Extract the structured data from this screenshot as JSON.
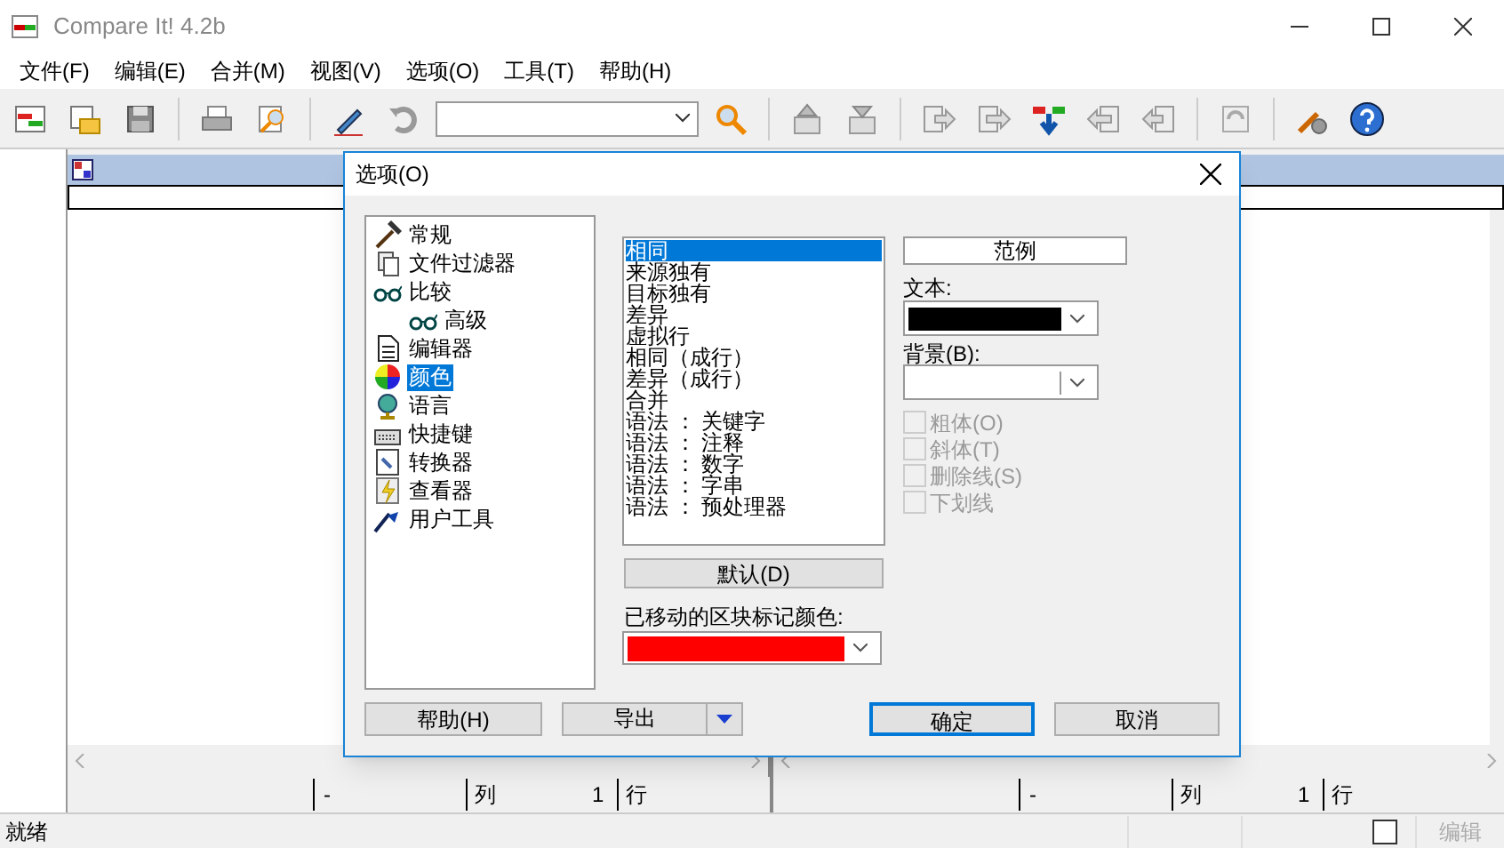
{
  "window": {
    "title": "Compare It! 4.2b"
  },
  "menu": [
    {
      "label": "文件(F)"
    },
    {
      "label": "编辑(E)"
    },
    {
      "label": "合并(M)"
    },
    {
      "label": "视图(V)"
    },
    {
      "label": "选项(O)"
    },
    {
      "label": "工具(T)"
    },
    {
      "label": "帮助(H)"
    }
  ],
  "panes": [
    {
      "col_sep": "-",
      "col_label": "列",
      "number": "1",
      "row_label": "行"
    },
    {
      "col_sep": "-",
      "col_label": "列",
      "number": "1",
      "row_label": "行"
    }
  ],
  "status_bar": {
    "text": "就绪",
    "checked": false,
    "mode": "编辑",
    "mode_disabled": true
  },
  "dialog": {
    "title": "选项(O)",
    "tree": [
      {
        "label": "常规",
        "selected": false
      },
      {
        "label": "文件过滤器",
        "selected": false
      },
      {
        "label": "比较",
        "selected": false,
        "children": [
          {
            "label": "高级",
            "selected": false
          }
        ]
      },
      {
        "label": "编辑器",
        "selected": false
      },
      {
        "label": "颜色",
        "selected": true
      },
      {
        "label": "语言",
        "selected": false
      },
      {
        "label": "快捷键",
        "selected": false
      },
      {
        "label": "转换器",
        "selected": false
      },
      {
        "label": "查看器",
        "selected": false
      },
      {
        "label": "用户工具",
        "selected": false
      }
    ],
    "color_items": [
      {
        "label": "相同",
        "selected": true
      },
      {
        "label": "来源独有",
        "selected": false
      },
      {
        "label": "目标独有",
        "selected": false
      },
      {
        "label": "差异",
        "selected": false
      },
      {
        "label": "虚拟行",
        "selected": false
      },
      {
        "label": "相同（成行）",
        "selected": false
      },
      {
        "label": "差异（成行）",
        "selected": false
      },
      {
        "label": "合并",
        "selected": false
      },
      {
        "label": "语法 ： 关键字",
        "selected": false
      },
      {
        "label": "语法 ： 注释",
        "selected": false
      },
      {
        "label": "语法 ： 数字",
        "selected": false
      },
      {
        "label": "语法 ： 字串",
        "selected": false
      },
      {
        "label": "语法 ： 预处理器",
        "selected": false
      }
    ],
    "default_button": "默认(D)",
    "sample_label": "范例",
    "color_pickers": [
      {
        "label": "文本:",
        "color": "#000000"
      },
      {
        "label": "背景(B):",
        "color": "#ffffff"
      },
      {
        "label": "已移动的区块标记颜色:",
        "color": "#ff0000"
      }
    ],
    "styles": [
      {
        "label": "粗体(O)",
        "checked": false,
        "disabled": true
      },
      {
        "label": "斜体(T)",
        "checked": false,
        "disabled": true
      },
      {
        "label": "删除线(S)",
        "checked": false,
        "disabled": true
      },
      {
        "label": "下划线",
        "checked": false,
        "disabled": true
      }
    ],
    "buttons": [
      {
        "label": "帮助(H)",
        "kind": "normal"
      },
      {
        "label": "导出",
        "kind": "split"
      },
      {
        "label": "确定",
        "kind": "default"
      },
      {
        "label": "取消",
        "kind": "normal"
      }
    ]
  }
}
